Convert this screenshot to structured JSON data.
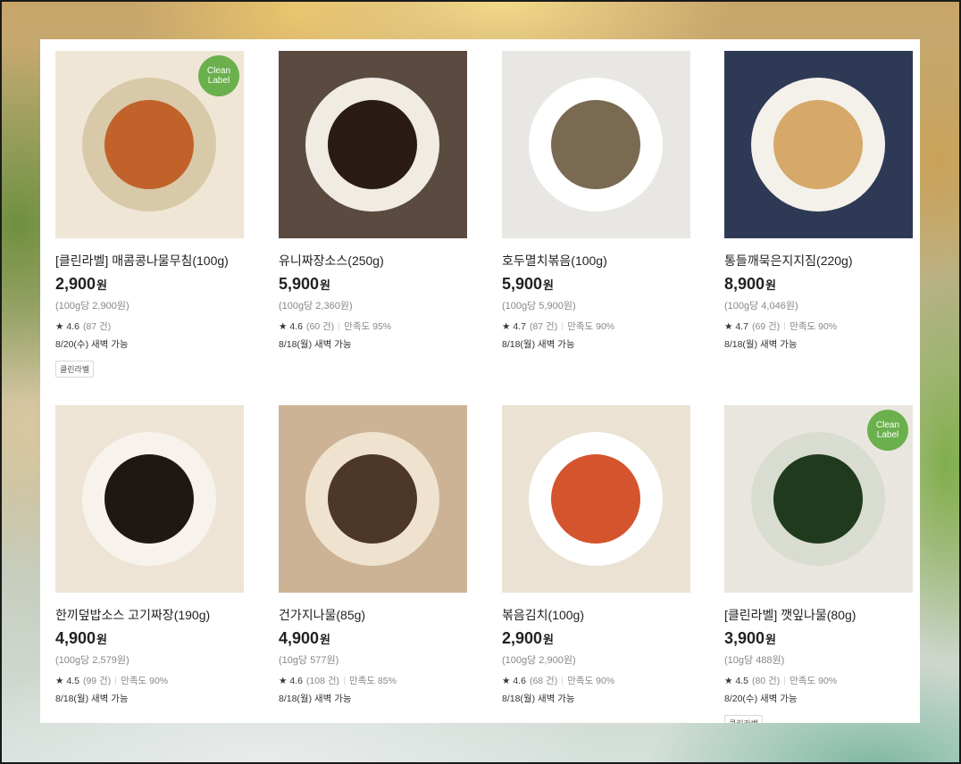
{
  "products": [
    {
      "name": "[클린라벨] 매콤콩나물무침(100g)",
      "price": "2,900",
      "currency": "원",
      "unit_price": "(100g당 2,900원)",
      "star": "★",
      "rating": "4.6",
      "reviews": "(87 건)",
      "satisfaction": "",
      "delivery": "8/20(수) 새벽 가능",
      "tag": "클린라벨",
      "badge_line1": "Clean",
      "badge_line2": "Label",
      "bg": "#efe6d6",
      "plate": "#d8c9a8",
      "food": "#c0622a"
    },
    {
      "name": "유니짜장소스(250g)",
      "price": "5,900",
      "currency": "원",
      "unit_price": "(100g당 2,360원)",
      "star": "★",
      "rating": "4.6",
      "reviews": "(60 건)",
      "satisfaction": "만족도 95%",
      "delivery": "8/18(월) 새벽 가능",
      "tag": "",
      "badge_line1": "",
      "badge_line2": "",
      "bg": "#5b4a40",
      "plate": "#f1ece3",
      "food": "#2a1b16"
    },
    {
      "name": "호두멸치볶음(100g)",
      "price": "5,900",
      "currency": "원",
      "unit_price": "(100g당 5,900원)",
      "star": "★",
      "rating": "4.7",
      "reviews": "(87 건)",
      "satisfaction": "만족도 90%",
      "delivery": "8/18(월) 새벽 가능",
      "tag": "",
      "badge_line1": "",
      "badge_line2": "",
      "bg": "#e9e7e4",
      "plate": "#ffffff",
      "food": "#7a6a52"
    },
    {
      "name": "통들깨묵은지지짐(220g)",
      "price": "8,900",
      "currency": "원",
      "unit_price": "(100g당 4,046원)",
      "star": "★",
      "rating": "4.7",
      "reviews": "(69 건)",
      "satisfaction": "만족도 90%",
      "delivery": "8/18(월) 새벽 가능",
      "tag": "",
      "badge_line1": "",
      "badge_line2": "",
      "bg": "#2e3a55",
      "plate": "#f4f1ea",
      "food": "#d6a96a"
    },
    {
      "name": "한끼덮밥소스 고기짜장(190g)",
      "price": "4,900",
      "currency": "원",
      "unit_price": "(100g당 2,579원)",
      "star": "★",
      "rating": "4.5",
      "reviews": "(99 건)",
      "satisfaction": "만족도 90%",
      "delivery": "8/18(월) 새벽 가능",
      "tag": "",
      "badge_line1": "",
      "badge_line2": "",
      "bg": "#ede4d6",
      "plate": "#f7f3ec",
      "food": "#1f1713"
    },
    {
      "name": "건가지나물(85g)",
      "price": "4,900",
      "currency": "원",
      "unit_price": "(10g당 577원)",
      "star": "★",
      "rating": "4.6",
      "reviews": "(108 건)",
      "satisfaction": "만족도 85%",
      "delivery": "8/18(월) 새벽 가능",
      "tag": "",
      "badge_line1": "",
      "badge_line2": "",
      "bg": "#cdb396",
      "plate": "#efe3cf",
      "food": "#4d3726"
    },
    {
      "name": "볶음김치(100g)",
      "price": "2,900",
      "currency": "원",
      "unit_price": "(100g당 2,900원)",
      "star": "★",
      "rating": "4.6",
      "reviews": "(68 건)",
      "satisfaction": "만족도 90%",
      "delivery": "8/18(월) 새벽 가능",
      "tag": "",
      "badge_line1": "",
      "badge_line2": "",
      "bg": "#ebe2d4",
      "plate": "#ffffff",
      "food": "#d4542e"
    },
    {
      "name": "[클린라벨] 깻잎나물(80g)",
      "price": "3,900",
      "currency": "원",
      "unit_price": "(10g당 488원)",
      "star": "★",
      "rating": "4.5",
      "reviews": "(80 건)",
      "satisfaction": "만족도 90%",
      "delivery": "8/20(수) 새벽 가능",
      "tag": "클린라벨",
      "badge_line1": "Clean",
      "badge_line2": "Label",
      "bg": "#e9e6df",
      "plate": "#d9dcd0",
      "food": "#1f3a1c"
    }
  ]
}
